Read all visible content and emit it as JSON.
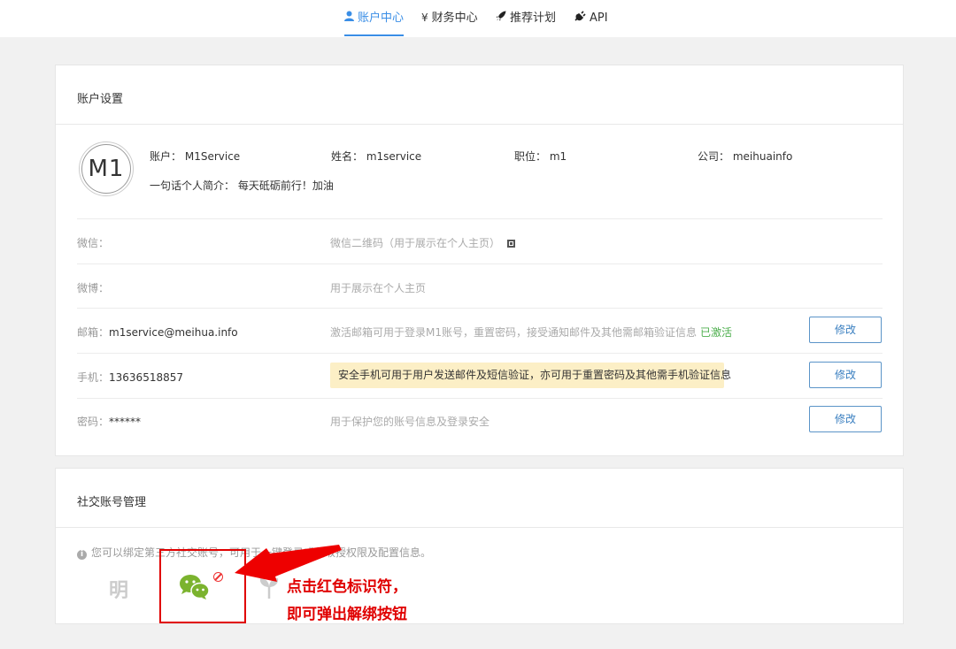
{
  "nav": {
    "items": [
      {
        "label": "账户中心",
        "icon": "user-icon",
        "active": true
      },
      {
        "label": "财务中心",
        "icon": "yen-icon",
        "active": false
      },
      {
        "label": "推荐计划",
        "icon": "rocket-icon",
        "active": false
      },
      {
        "label": "API",
        "icon": "plug-icon",
        "active": false
      }
    ]
  },
  "account_settings": {
    "title": "账户设置",
    "avatar_text": "M1",
    "profile": {
      "account_label": "账户：",
      "account_value": "M1Service",
      "name_label": "姓名：",
      "name_value": "m1service",
      "position_label": "职位：",
      "position_value": "m1",
      "company_label": "公司：",
      "company_value": "meihuainfo",
      "bio_label": "一句话个人简介：",
      "bio_value": "每天砥砺前行！加油"
    },
    "rows": {
      "wechat": {
        "label": "微信：",
        "desc": "微信二维码（用于展示在个人主页）"
      },
      "weibo": {
        "label": "微博：",
        "desc": "用于展示在个人主页"
      },
      "email": {
        "label": "邮箱：",
        "value": "m1service@meihua.info",
        "desc": "激活邮箱可用于登录M1账号，重置密码，接受通知邮件及其他需邮箱验证信息",
        "status": "已激活",
        "button": "修改"
      },
      "phone": {
        "label": "手机：",
        "value": "13636518857",
        "desc": "安全手机可用于用户发送邮件及短信验证，亦可用于重置密码及其他需手机验证信息",
        "button": "修改"
      },
      "password": {
        "label": "密码：",
        "value": "******",
        "desc": "用于保护您的账号信息及登录安全",
        "button": "修改"
      }
    }
  },
  "social": {
    "title": "社交账号管理",
    "info": "您可以绑定第三方社交账号，可用于一键登录或获取授权限及配置信息。",
    "accounts": [
      {
        "name": "明",
        "icon": "ming-icon"
      },
      {
        "name": "wechat",
        "icon": "wechat-icon",
        "bound": true
      },
      {
        "name": "plant",
        "icon": "plant-icon"
      }
    ],
    "annotation_line1": "点击红色标识符，",
    "annotation_line2": "即可弹出解绑按钮"
  },
  "colors": {
    "accent": "#3a8ee6",
    "warn_bg": "#fcefc6",
    "active_green": "#4cae4c",
    "annotation_red": "#e00000"
  }
}
